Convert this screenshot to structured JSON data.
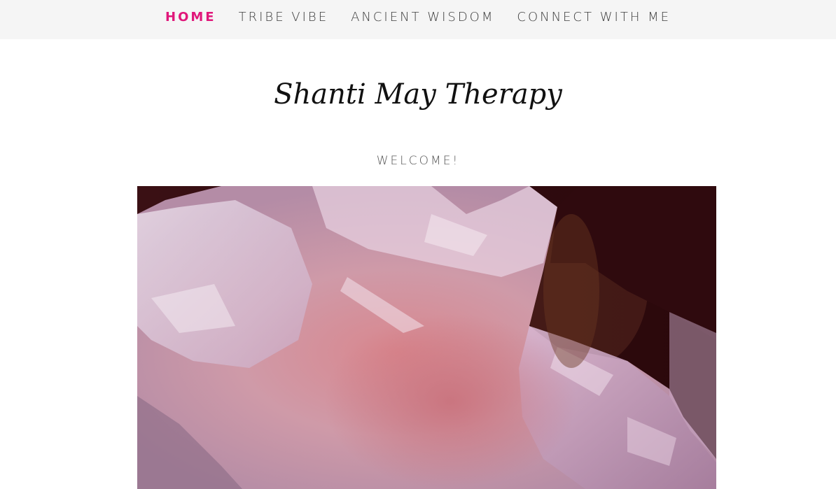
{
  "nav": {
    "items": [
      {
        "label": "HOME",
        "active": true
      },
      {
        "label": "TRIBE VIBE",
        "active": false
      },
      {
        "label": "ANCIENT WISDOM",
        "active": false
      },
      {
        "label": "CONNECT WITH ME",
        "active": false
      }
    ]
  },
  "brand": {
    "title": "Shanti May Therapy"
  },
  "hero": {
    "heading": "WELCOME!"
  },
  "colors": {
    "nav_background": "#f5f5f5",
    "active_accent": "#e0177a",
    "nav_text": "#3d3d3d",
    "hero_background": "#2a0a0c"
  }
}
